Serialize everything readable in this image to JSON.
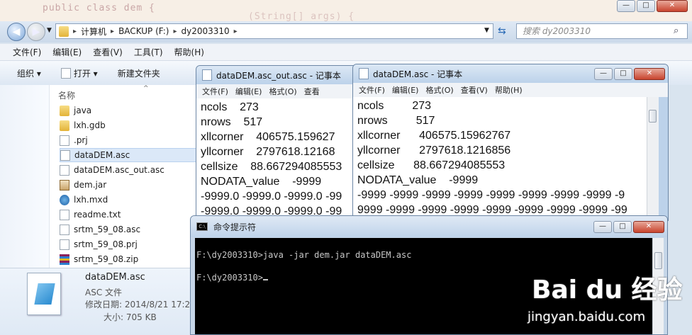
{
  "explorer": {
    "path": [
      "计算机",
      "BACKUP (F:)",
      "dy2003310"
    ],
    "search_placeholder": "搜索 dy2003310",
    "menu": [
      "文件(F)",
      "编辑(E)",
      "查看(V)",
      "工具(T)",
      "帮助(H)"
    ],
    "toolbar": {
      "organize": "组织 ▾",
      "open": "打开 ▾",
      "new_folder": "新建文件夹"
    },
    "column_name": "名称",
    "files": [
      {
        "name": "java",
        "icon": "folder-icon"
      },
      {
        "name": "lxh.gdb",
        "icon": "folder-icon"
      },
      {
        "name": ".prj",
        "icon": "document-icon"
      },
      {
        "name": "dataDEM.asc",
        "icon": "document-icon"
      },
      {
        "name": "dataDEM.asc_out.asc",
        "icon": "document-icon"
      },
      {
        "name": "dem.jar",
        "icon": "jar-icon"
      },
      {
        "name": "lxh.mxd",
        "icon": "mxd-icon"
      },
      {
        "name": "readme.txt",
        "icon": "document-icon"
      },
      {
        "name": "srtm_59_08.asc",
        "icon": "document-icon"
      },
      {
        "name": "srtm_59_08.prj",
        "icon": "document-icon"
      },
      {
        "name": "srtm_59_08.zip",
        "icon": "zip-icon"
      }
    ],
    "details": {
      "name": "dataDEM.asc",
      "type": "ASC 文件",
      "modified": "修改日期: 2014/8/21 17:2",
      "size": "大小: 705 KB"
    }
  },
  "notepad_out": {
    "title": "dataDEM.asc_out.asc - 记事本",
    "menu": [
      "文件(F)",
      "编辑(E)",
      "格式(O)",
      "查看"
    ],
    "text": "ncols    273\nnrows    517\nxllcorner    406575.159627\nyllcorner    2797618.12168\ncellsize    88.667294085553\nNODATA_value    -9999\n-9999.0 -9999.0 -9999.0 -99\n-9999.0 -9999.0 -9999.0 -99"
  },
  "notepad_in": {
    "title": "dataDEM.asc - 记事本",
    "menu": [
      "文件(F)",
      "编辑(E)",
      "格式(O)",
      "查看(V)",
      "帮助(H)"
    ],
    "text": "ncols         273\nnrows         517\nxllcorner      406575.15962767\nyllcorner      2797618.1216856\ncellsize      88.667294085553\nNODATA_value    -9999\n-9999 -9999 -9999 -9999 -9999 -9999 -9999 -9999 -9\n9999 -9999 -9999 -9999 -9999 -9999 -9999 -9999 -99"
  },
  "cmd": {
    "title": "命令提示符",
    "line1": "F:\\dy2003310>java -jar dem.jar dataDEM.asc",
    "line2": "F:\\dy2003310>"
  },
  "watermark": {
    "brand": "Bai du 经验",
    "url": "jingyan.baidu.com"
  }
}
